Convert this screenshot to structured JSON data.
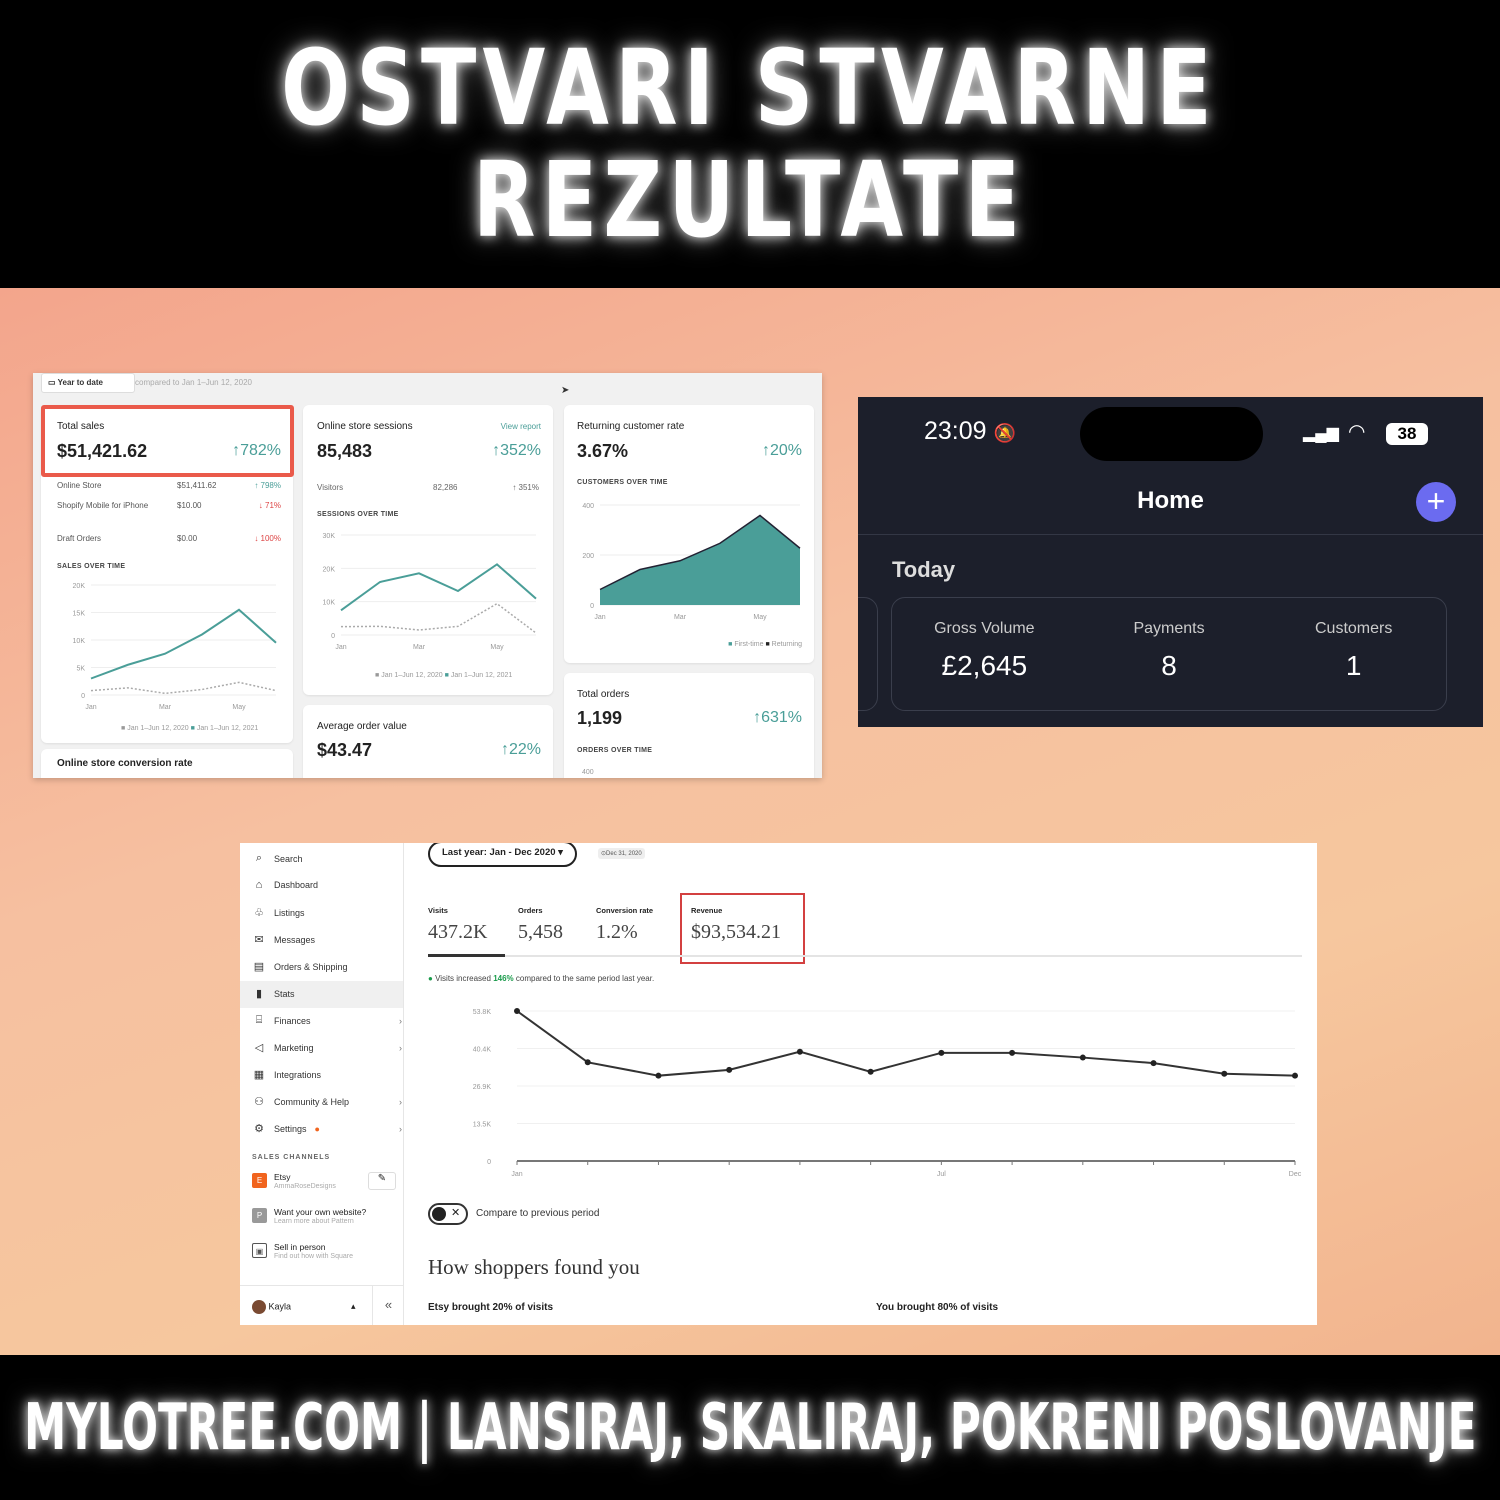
{
  "headline": {
    "line1": "OSTVARI STVARNE",
    "line2": "REZULTATE"
  },
  "footer": "MYLOTREE.COM  |  LANSIRAJ, SKALIRAJ, POKRENI POSLOVANJE",
  "shopify": {
    "date_button": "Year to date",
    "compared": "compared to Jan 1–Jun 12, 2020",
    "total_sales": {
      "title": "Total sales",
      "value": "$51,421.62",
      "change": "↑782%",
      "rows": [
        {
          "name": "Online Store",
          "value": "$51,411.62",
          "change": "↑ 798%"
        },
        {
          "name": "Shopify Mobile for iPhone",
          "value": "$10.00",
          "change": "↓ 71%"
        },
        {
          "name": "Draft Orders",
          "value": "$0.00",
          "change": "↓ 100%"
        }
      ],
      "chart_caption": "SALES OVER TIME"
    },
    "sessions": {
      "title": "Online store sessions",
      "link": "View report",
      "value": "85,483",
      "change": "↑352%",
      "visitors_label": "Visitors",
      "visitors_value": "82,286",
      "visitors_change": "↑ 351%",
      "chart_caption": "SESSIONS OVER TIME"
    },
    "returning": {
      "title": "Returning customer rate",
      "value": "3.67%",
      "change": "↑20%",
      "chart_caption": "CUSTOMERS OVER TIME"
    },
    "aov": {
      "title": "Average order value",
      "value": "$43.47",
      "change": "↑22%"
    },
    "orders": {
      "title": "Total orders",
      "value": "1,199",
      "change": "↑631%",
      "chart_caption": "ORDERS OVER TIME",
      "tick": "400"
    },
    "conversion": {
      "title": "Online store conversion rate"
    },
    "legend": {
      "prev": "Jan 1–Jun 12, 2020",
      "curr": "Jan 1–Jun 12, 2021",
      "first": "First-time",
      "returning": "Returning"
    },
    "accent": "#4a9e98"
  },
  "chart_data": [
    {
      "type": "line",
      "title": "SALES OVER TIME",
      "categories": [
        "Jan",
        "",
        "Mar",
        "",
        "May",
        ""
      ],
      "yticks": [
        "20K",
        "15K",
        "10K",
        "5K",
        "0"
      ],
      "ylim": [
        0,
        20000
      ],
      "series": [
        {
          "name": "Jan 1–Jun 12, 2020",
          "values": [
            800,
            1300,
            300,
            1000,
            2300,
            800
          ]
        },
        {
          "name": "Jan 1–Jun 12, 2021",
          "values": [
            3000,
            5500,
            7500,
            11000,
            15500,
            9500
          ]
        }
      ]
    },
    {
      "type": "line",
      "title": "SESSIONS OVER TIME",
      "categories": [
        "Jan",
        "",
        "Mar",
        "",
        "May",
        ""
      ],
      "yticks": [
        "30K",
        "20K",
        "10K",
        "0"
      ],
      "ylim": [
        0,
        30000
      ],
      "series": [
        {
          "name": "Jan 1–Jun 12, 2020",
          "values": [
            2500,
            2600,
            1500,
            2600,
            9400,
            600
          ]
        },
        {
          "name": "Jan 1–Jun 12, 2021",
          "values": [
            7400,
            15900,
            18500,
            13200,
            21200,
            10900
          ]
        }
      ]
    },
    {
      "type": "area",
      "title": "CUSTOMERS OVER TIME",
      "categories": [
        "Jan",
        "",
        "Mar",
        "",
        "May",
        ""
      ],
      "yticks": [
        "400",
        "200",
        "0"
      ],
      "ylim": [
        0,
        400
      ],
      "series": [
        {
          "name": "First-time",
          "values": [
            60,
            140,
            175,
            245,
            355,
            225
          ]
        },
        {
          "name": "Returning",
          "values": [
            62,
            142,
            177,
            247,
            358,
            227
          ]
        }
      ]
    },
    {
      "type": "line",
      "title": "Visits",
      "categories": [
        "Jan",
        "",
        "",
        "",
        "",
        "",
        "Jul",
        "",
        "",
        "",
        "",
        "Dec"
      ],
      "yticks": [
        "53.8K",
        "40.4K",
        "26.9K",
        "13.5K",
        "0"
      ],
      "ylim": [
        0,
        53800
      ],
      "series": [
        {
          "values": [
            53800,
            35400,
            30600,
            32700,
            39200,
            32000,
            38800,
            38800,
            37100,
            35100,
            31300,
            30600
          ]
        }
      ]
    }
  ],
  "phone": {
    "time": "23:09",
    "battery": "38",
    "title": "Home",
    "section": "Today",
    "stats": [
      {
        "label": "Gross Volume",
        "value": "£2,645"
      },
      {
        "label": "Payments",
        "value": "8"
      },
      {
        "label": "Customers",
        "value": "1"
      }
    ],
    "accent": "#6b6bf0"
  },
  "etsy": {
    "nav": [
      {
        "label": "Search",
        "icon": "⌕"
      },
      {
        "label": "Dashboard",
        "icon": "⌂"
      },
      {
        "label": "Listings",
        "icon": "♧"
      },
      {
        "label": "Messages",
        "icon": "✉"
      },
      {
        "label": "Orders & Shipping",
        "icon": "▤"
      },
      {
        "label": "Stats",
        "icon": "▮"
      },
      {
        "label": "Finances",
        "icon": "⌸"
      },
      {
        "label": "Marketing",
        "icon": "◁"
      },
      {
        "label": "Integrations",
        "icon": "▦"
      },
      {
        "label": "Community & Help",
        "icon": "⚇"
      },
      {
        "label": "Settings",
        "icon": "⚙"
      }
    ],
    "sales_channels": "SALES CHANNELS",
    "channels": [
      {
        "badge": "E",
        "name": "Etsy",
        "sub": "AmmaRoseDesigns"
      },
      {
        "badge": "P",
        "name": "Want your own website?",
        "sub": "Learn more about Pattern"
      },
      {
        "badge": "▣",
        "name": "Sell in person",
        "sub": "Find out how with Square"
      }
    ],
    "user": "Kayla",
    "date_range": "Last year: Jan - Dec 2020 ▾",
    "date_chip": "⊙Dec 31, 2020",
    "metrics": [
      {
        "label": "Visits",
        "value": "437.2K"
      },
      {
        "label": "Orders",
        "value": "5,458"
      },
      {
        "label": "Conversion rate",
        "value": "1.2%"
      },
      {
        "label": "Revenue",
        "value": "$93,534.21"
      }
    ],
    "notice_pre": "Visits increased ",
    "notice_pct": "146%",
    "notice_post": " compared to the same period last year.",
    "compare": "Compare to previous period",
    "heading": "How shoppers found you",
    "etsy_brought": "Etsy brought 20% of visits",
    "you_brought": "You brought 80% of visits"
  }
}
